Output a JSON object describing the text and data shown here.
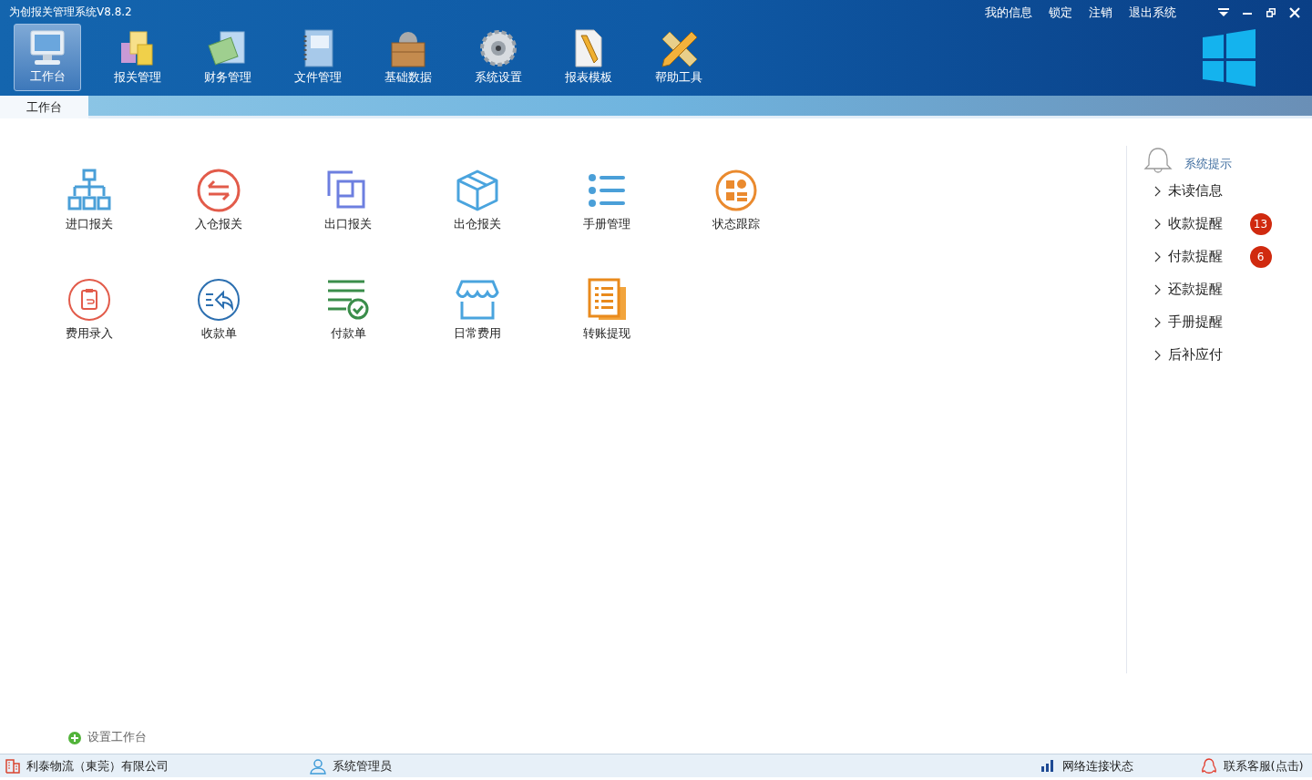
{
  "window": {
    "title": "为创报关管理系统V8.8.2"
  },
  "top_links": [
    "我的信息",
    "锁定",
    "注销",
    "退出系统"
  ],
  "menu": [
    {
      "label": "工作台",
      "selected": true
    },
    {
      "label": "报关管理",
      "selected": false
    },
    {
      "label": "财务管理",
      "selected": false
    },
    {
      "label": "文件管理",
      "selected": false
    },
    {
      "label": "基础数据",
      "selected": false
    },
    {
      "label": "系统设置",
      "selected": false
    },
    {
      "label": "报表模板",
      "selected": false
    },
    {
      "label": "帮助工具",
      "selected": false
    }
  ],
  "tabs": [
    {
      "label": "工作台",
      "selected": true
    }
  ],
  "shortcuts": [
    [
      "进口报关",
      "入仓报关",
      "出口报关",
      "出仓报关",
      "手册管理",
      "状态跟踪"
    ],
    [
      "费用录入",
      "收款单",
      "付款单",
      "日常费用",
      "转账提现"
    ]
  ],
  "settings_link": "设置工作台",
  "notices": {
    "title": "系统提示",
    "items": [
      {
        "label": "未读信息"
      },
      {
        "label": "收款提醒",
        "count": "13"
      },
      {
        "label": "付款提醒",
        "count": "6"
      },
      {
        "label": "还款提醒"
      },
      {
        "label": "手册提醒"
      },
      {
        "label": "后补应付"
      }
    ]
  },
  "status_bar": {
    "company": "利泰物流（東莞）有限公司",
    "user": "系统管理员",
    "network": "网络连接状态",
    "support": "联系客服(点击)"
  }
}
